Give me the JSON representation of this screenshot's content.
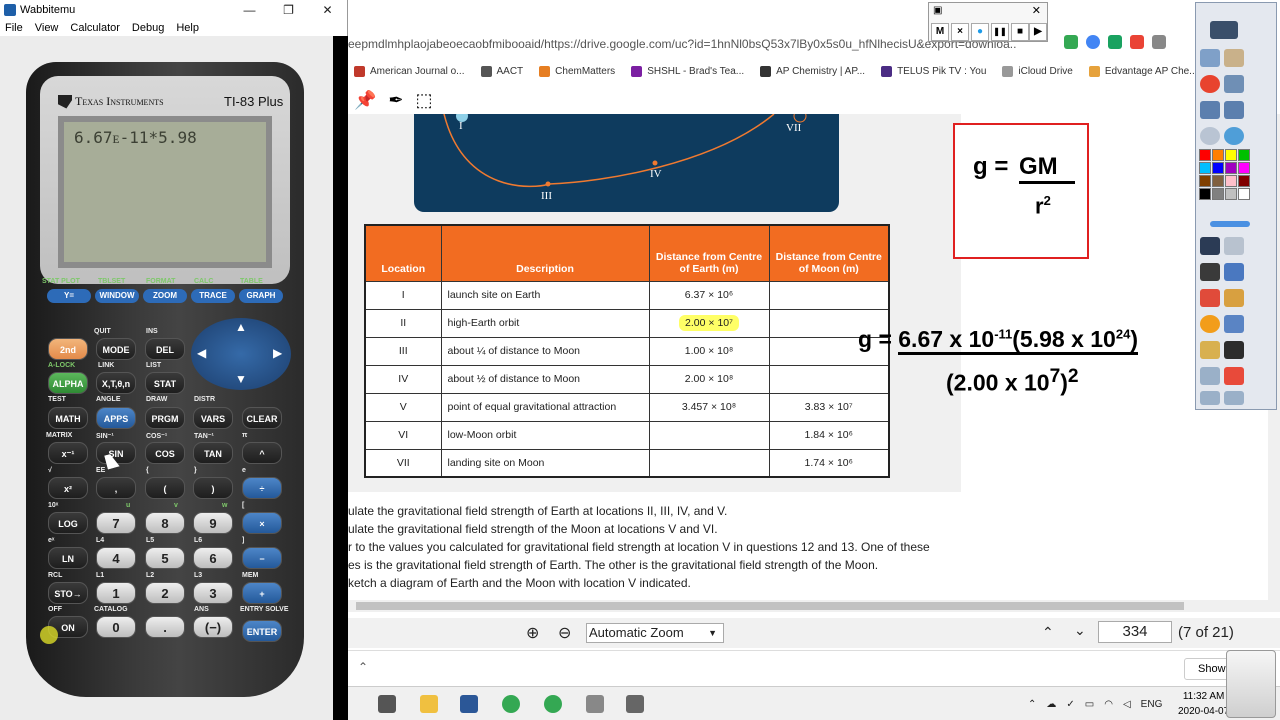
{
  "wabbit": {
    "title": "Wabbitemu",
    "menu": [
      "File",
      "View",
      "Calculator",
      "Debug",
      "Help"
    ],
    "calc": {
      "brand": "Texas Instruments",
      "model": "TI-83 Plus",
      "screen_text": "6.67ᴇ-11*5.98",
      "fkeys": [
        {
          "top": "STAT PLOT",
          "fn": "F1",
          "label": "Y="
        },
        {
          "top": "TBLSET",
          "fn": "F2",
          "label": "WINDOW"
        },
        {
          "top": "FORMAT",
          "fn": "F3",
          "label": "ZOOM"
        },
        {
          "top": "CALC",
          "fn": "F4",
          "label": "TRACE"
        },
        {
          "top": "TABLE",
          "fn": "F5",
          "label": "GRAPH"
        }
      ],
      "keys": {
        "second": "2nd",
        "mode": "MODE",
        "del": "DEL",
        "quit": "QUIT",
        "ins": "INS",
        "alpha": "ALPHA",
        "xton": "X,T,θ,n",
        "stat": "STAT",
        "alock": "A-LOCK",
        "link": "LINK",
        "list": "LIST",
        "math": "MATH",
        "apps": "APPS",
        "prgm": "PRGM",
        "vars": "VARS",
        "clear": "CLEAR",
        "test": "TEST",
        "angle": "ANGLE",
        "draw": "DRAW",
        "distr": "DISTR",
        "xinv": "x⁻¹",
        "sin": "SIN",
        "cos": "COS",
        "tan": "TAN",
        "pow": "^",
        "matrix": "MATRIX",
        "sininv": "SIN⁻¹",
        "cosinv": "COS⁻¹",
        "taninv": "TAN⁻¹",
        "pi": "π",
        "xsq": "x²",
        "comma": ",",
        "lparen": "(",
        "rparen": ")",
        "div": "÷",
        "sqrt": "√",
        "ee": "EE",
        "lbrace": "{",
        "rbrace": "}",
        "e": "e",
        "log": "LOG",
        "k7": "7",
        "k8": "8",
        "k9": "9",
        "mul": "×",
        "tenx": "10ˣ",
        "u": "u",
        "v": "v",
        "w": "w",
        "lbrack": "[",
        "ln": "LN",
        "k4": "4",
        "k5": "5",
        "k6": "6",
        "sub": "−",
        "ex": "eˣ",
        "l4": "L4",
        "l5": "L5",
        "l6": "L6",
        "rbrack": "]",
        "sto": "STO→",
        "k1": "1",
        "k2": "2",
        "k3": "3",
        "add": "+",
        "rcl": "RCL",
        "l1": "L1",
        "l2": "L2",
        "l3": "L3",
        "mem": "MEM",
        "on": "ON",
        "k0": "0",
        "dot": ".",
        "neg": "(−)",
        "enter": "ENTER",
        "off": "OFF",
        "catalog": "CATALOG",
        "ans": "ANS",
        "entry": "ENTRY SOLVE"
      }
    }
  },
  "browser": {
    "url": "eepmdlmhplaojabeoecaobfmibooaid/https://drive.google.com/uc?id=1hnNl0bsQ53x7lBy0x5s0u_hfNlhecisU&export=downloa...",
    "bookmarks": [
      "American Journal o...",
      "AACT",
      "ChemMatters",
      "SHSHL - Brad's Tea...",
      "AP Chemistry | AP...",
      "TELUS Pik TV : You",
      "iCloud Drive",
      "Edvantage AP Che..."
    ],
    "recorder": {
      "buttons": [
        "M",
        "×",
        "●",
        "❚❚",
        "■",
        "▶"
      ]
    },
    "diagram_labels": [
      "I",
      "VII",
      "IV",
      "III"
    ],
    "table": {
      "headers": [
        "Location",
        "Description",
        "Distance from Centre of Earth (m)",
        "Distance from Centre of Moon (m)"
      ],
      "rows": [
        {
          "loc": "I",
          "desc": "launch site on Earth",
          "earth": "6.37 × 10⁶",
          "moon": ""
        },
        {
          "loc": "II",
          "desc": "high-Earth orbit",
          "earth": "2.00 × 10⁷",
          "moon": ""
        },
        {
          "loc": "III",
          "desc": "about ¼ of distance to Moon",
          "earth": "1.00 × 10⁸",
          "moon": ""
        },
        {
          "loc": "IV",
          "desc": "about ½ of distance to Moon",
          "earth": "2.00 × 10⁸",
          "moon": ""
        },
        {
          "loc": "V",
          "desc": "point of equal gravitational attraction",
          "earth": "3.457 × 10⁸",
          "moon": "3.83 × 10⁷"
        },
        {
          "loc": "VI",
          "desc": "low-Moon orbit",
          "earth": "",
          "moon": "1.84 × 10⁶"
        },
        {
          "loc": "VII",
          "desc": "landing site on Moon",
          "earth": "",
          "moon": "1.74 × 10⁶"
        }
      ]
    },
    "questions": [
      "ulate the gravitational field strength of Earth at locations II, III, IV, and V.",
      "ulate the gravitational field strength of the Moon at locations V and VI.",
      "r to the values you calculated for gravitational field strength at location V in questions 12 and 13. One of these",
      "es is the gravitational field strength of Earth. The other is the gravitational field strength of the Moon.",
      "ketch a diagram of Earth and the Moon with location V indicated."
    ],
    "formula_box": {
      "g": "g =",
      "gm": "GM",
      "r2": "r"
    },
    "calc_formula": {
      "lhs": "g = ",
      "num": "6.67 x 10",
      "exp1": "-11",
      "num2": "(5.98 x 10",
      "exp2": "24",
      "close": ")",
      "den": "(2.00 x 10",
      "exp3": "7",
      "den_close": ")",
      "den_exp": "2"
    },
    "pdf_bottom": {
      "zoom": "Automatic Zoom",
      "page": "334",
      "page_of": "(7 of 21)"
    },
    "downloads": {
      "show_all": "Show"
    }
  },
  "taskbar": {
    "lang": "ENG",
    "time": "11:32 AM",
    "date": "2020-04-07"
  }
}
